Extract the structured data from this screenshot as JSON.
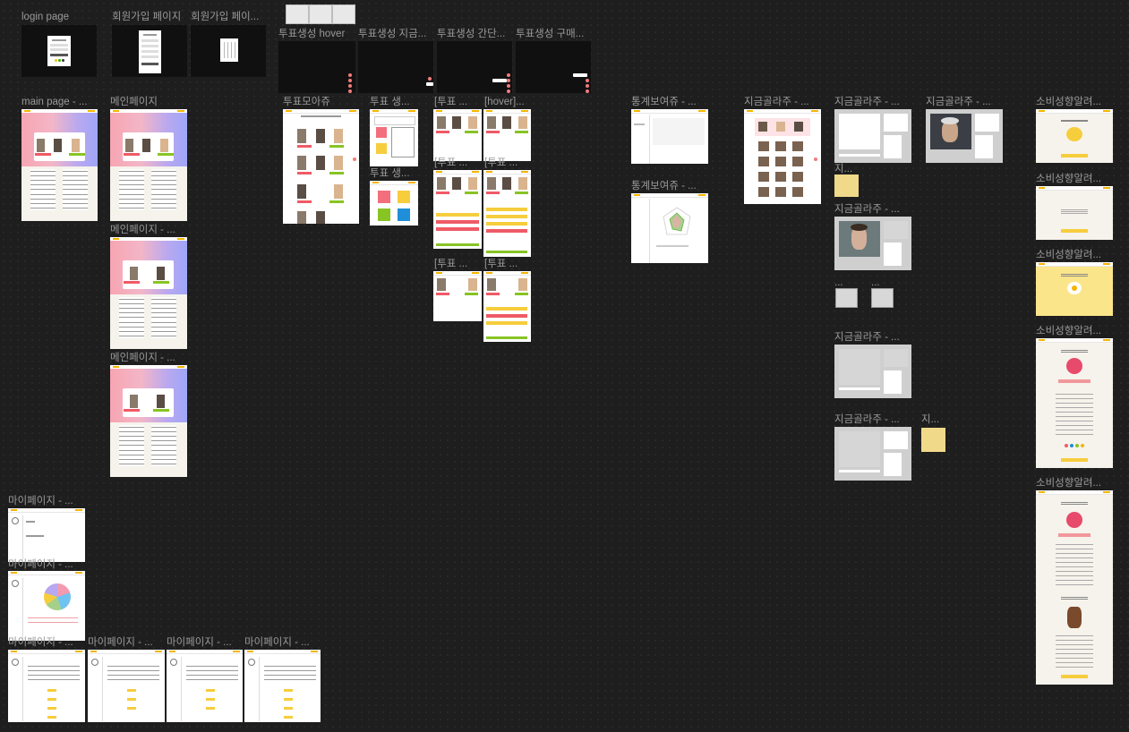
{
  "canvas": {
    "labels": {
      "login": "login page",
      "signup1": "회원가입 페이지",
      "signup2": "회원가입 페이...",
      "vote_hover": "투표생성 hover",
      "vote_now": "투표생성 지금...",
      "vote_simple": "투표생성 간단...",
      "vote_buy": "투표생성 구매...",
      "main_page": "main page - ...",
      "main1": "메인페이지",
      "main2": "메인페이지 - ...",
      "main3": "메인페이지 - ...",
      "vote_collect": "투표모아쥬",
      "vote_gen1": "투표 생...",
      "vote_gen2": "투표 생...",
      "vote_a": "[투표 ...",
      "vote_hover2": "[hover]...",
      "vote_b": "[투표 ...",
      "vote_c": "[투표 ...",
      "vote_d": "[투표 ...",
      "vote_e": "[투표 ...",
      "stats1": "통계보여쥬 - ...",
      "stats2": "통계보여쥬 - ...",
      "now_pick_main": "지금골라주 - ...",
      "now_pick1": "지금골라주 - ...",
      "now_pick2": "지금골라주 - ...",
      "now_pick3": "지금골라주 - ...",
      "now_pick4": "지금골라주 - ...",
      "now_pick5": "지금골라주 - ...",
      "now_pick_small1": "지...",
      "now_pick_small2": "지...",
      "tiny1": "...",
      "tiny2": "...",
      "consume1": "소비성향알려...",
      "consume2": "소비성향알려...",
      "consume3": "소비성향알려...",
      "consume4": "소비성향알려...",
      "consume5": "소비성향알려...",
      "mypage1": "마이페이지 - ...",
      "mypage2": "마이페이지 - ...",
      "mypage3": "마이페이지 - ...",
      "mypage4": "마이페이지 - ...",
      "mypage5": "마이페이지 - ...",
      "mypage6": "마이페이지 - ..."
    }
  }
}
